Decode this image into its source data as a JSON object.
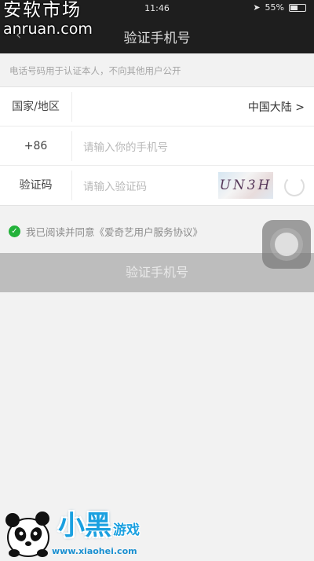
{
  "status_bar": {
    "time": "11:46",
    "battery": "55%",
    "battery_level": 0.55
  },
  "nav": {
    "title": "验证手机号",
    "back_icon": "chevron-left-icon"
  },
  "watermark_top": {
    "chinese": "安软市场",
    "url": "anruan.com"
  },
  "hint": "电话号码用于认证本人，不向其他用户公开",
  "form": {
    "country_label": "国家/地区",
    "country_value": "中国大陆 >",
    "phone_prefix": "+86",
    "phone_placeholder": "请输入你的手机号",
    "code_label": "验证码",
    "code_placeholder": "请输入验证码",
    "captcha_text": "UN3H"
  },
  "agreement": "我已阅读并同意《爱奇艺用户服务协议》",
  "verify_button": "验证手机号",
  "watermark_bottom": {
    "brand_big": "小黑",
    "brand_small": "游戏",
    "url": "www.xiaohei.com"
  },
  "colors": {
    "topbar": "#1e1e1e",
    "background": "#f2f2f2",
    "check": "#23b23a",
    "button_disabled": "#bdbdbd",
    "brand_blue": "#1aa0e0"
  }
}
